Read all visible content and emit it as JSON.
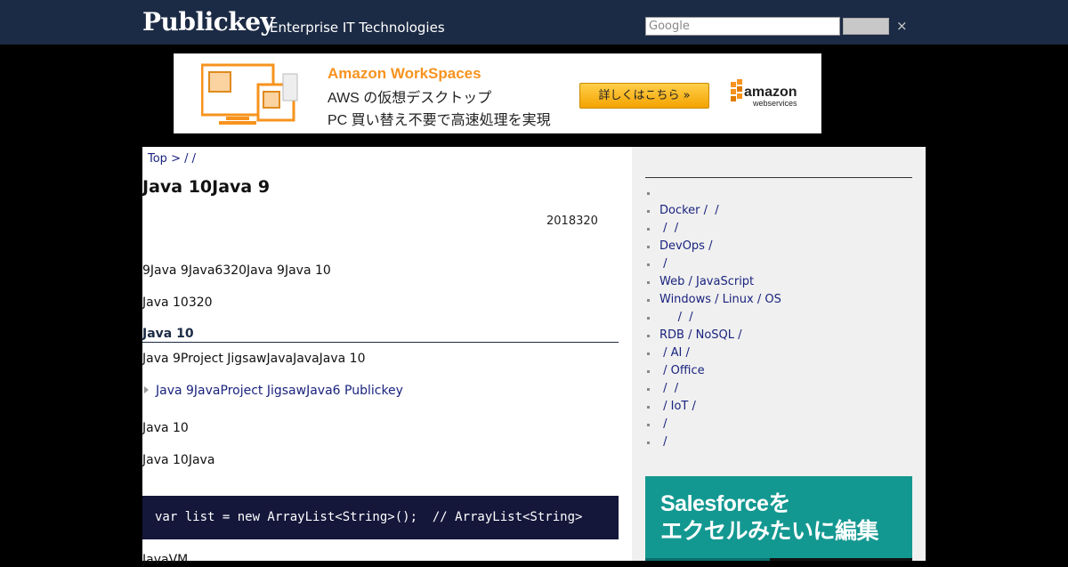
{
  "header": {
    "logo": "Publickey",
    "tagline": "Enterprise IT Technologies",
    "search_placeholder": "Google",
    "close_symbol": "×"
  },
  "ad": {
    "title": "Amazon WorkSpaces",
    "line1": "AWS の仮想デスクトップ",
    "line2": "PC 買い替え不要で高速処理を実現",
    "button_label": "詳しくはこちら »",
    "brand_main": "amazon",
    "brand_sub": "webservices",
    "accent_color": "#f7931e"
  },
  "breadcrumb": {
    "top": "Top",
    "sep": " >  /  /"
  },
  "article": {
    "title": "Java 10Java 9",
    "date": "2018320",
    "para1": "9Java 9Java6320Java 9Java 10",
    "para2": "Java 10320",
    "section_heading": "Java 10",
    "para3": "Java 9Project JigsawJavaJavaJava 10",
    "related_link": "Java 9JavaProject JigsawJava6  Publickey",
    "para4": "Java 10",
    "para5": "Java 10Java",
    "code": "var list = new ArrayList<String>();  // ArrayList<String>",
    "para6": "JavaVM"
  },
  "sidebar": {
    "categories": [
      "",
      "Docker /  /",
      " /  /",
      "DevOps /",
      " /",
      "Web / JavaScript",
      "Windows / Linux / OS",
      "     /  /",
      "RDB / NoSQL /",
      " / AI /",
      " / Office",
      " /  /",
      " / IoT /",
      " /",
      " /"
    ],
    "ad_text_line1": "Salesforceを",
    "ad_text_line2": "エクセルみたいに編集",
    "ad_color": "#139891"
  }
}
